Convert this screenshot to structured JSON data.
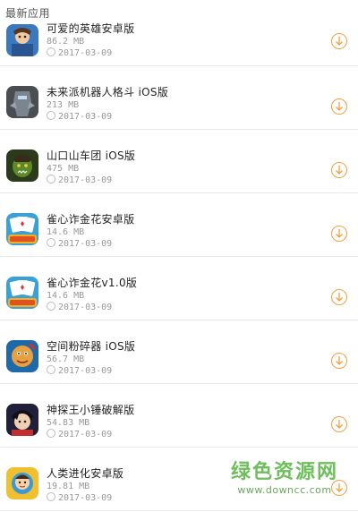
{
  "section": {
    "title": "最新应用"
  },
  "apps": [
    {
      "name": "可爱的英雄安卓版",
      "size": "86.2 MB",
      "date": "2017-03-09",
      "icon": "hero-icon"
    },
    {
      "name": "未来派机器人格斗 iOS版",
      "size": "213 MB",
      "date": "2017-03-09",
      "icon": "robot-fight-icon"
    },
    {
      "name": "山口山车团 iOS版",
      "size": "475 MB",
      "date": "2017-03-09",
      "icon": "orc-icon"
    },
    {
      "name": "雀心诈金花安卓版",
      "size": "14.6 MB",
      "date": "2017-03-09",
      "icon": "card-game-icon"
    },
    {
      "name": "雀心诈金花v1.0版",
      "size": "14.6 MB",
      "date": "2017-03-09",
      "icon": "card-game-icon"
    },
    {
      "name": "空间粉碎器 iOS版",
      "size": "56.7 MB",
      "date": "2017-03-09",
      "icon": "space-smash-icon"
    },
    {
      "name": "神探王小锤破解版",
      "size": "54.83 MB",
      "date": "2017-03-09",
      "icon": "detective-icon"
    },
    {
      "name": "人类进化安卓版",
      "size": "19.81 MB",
      "date": "2017-03-09",
      "icon": "evolution-icon"
    }
  ],
  "download_icon": "download-circle-icon",
  "watermark": {
    "title": "绿色资源网",
    "url": "www.downcc.com"
  },
  "colors": {
    "accent": "#f0a040",
    "watermark": "#5fb84a"
  }
}
